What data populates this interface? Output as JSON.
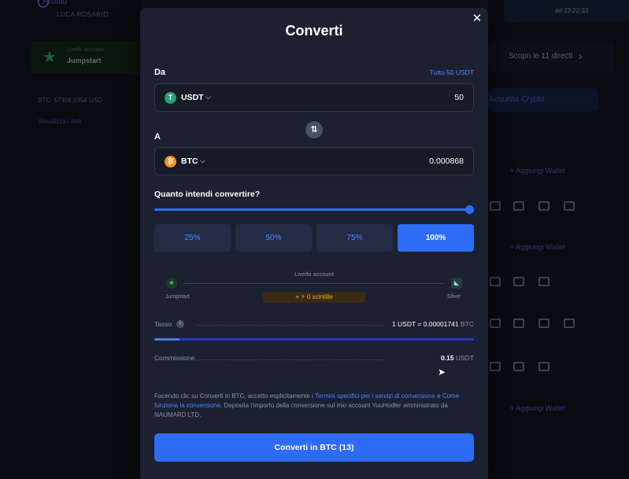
{
  "background": {
    "profile_label": "Profilo",
    "profile_name": "LUCA ROSARIO",
    "level_caption": "Livello account",
    "level_name": "Jumpstart",
    "btc_price": "BTC: 57308,0354 USD",
    "link": "Visualizza i dati",
    "datetime": "ad 23:22:33",
    "strip_text": "Scopri le 11 directi",
    "blue_bar_text": "Acquista Crypto",
    "add_wallet_1": "+ Aggiungi Wallet",
    "add_wallet_2": "+ Aggiungi Wallet",
    "add_wallet_3": "+ Aggiungi Wallet"
  },
  "modal": {
    "title": "Converti",
    "close_icon": "close-icon",
    "from": {
      "label": "Da",
      "all_link": "Tutto 50 USDT",
      "coin": "USDT",
      "amount": "50"
    },
    "to": {
      "label": "A",
      "coin": "BTC",
      "amount": "0.000868"
    },
    "slider": {
      "question": "Quanto intendi convertire?",
      "value_fraction": 1.0
    },
    "percent_options": [
      "25%",
      "50%",
      "75%",
      "100%"
    ],
    "selected_percent": "100%",
    "level": {
      "title": "Livello account",
      "start": "Jumpstart",
      "end": "Silver",
      "sparks": "+ ⚡ 0 scintille"
    },
    "rate": {
      "label": "Tasso",
      "value": "1 USDT = 0.00001741",
      "unit": "BTC",
      "progress_fraction": 0.08
    },
    "fee": {
      "label": "Commissione",
      "value": "0.15",
      "unit": "USDT"
    },
    "legal": {
      "part1": "Facendo clic su Converti in BTC, accetto esplicitamente i ",
      "link1": "Termini specifici per i servizi di conversione",
      "part2": " e ",
      "link2": "Come funziona la conversione",
      "part3": ". Deposita l'importo della conversione sul mio account YouHodler amministrato da NAUMARD LTD."
    },
    "convert_button": "Converti in BTC (13)"
  },
  "colors": {
    "accent": "#2f6cf6",
    "link": "#4f86ff",
    "modal_bg": "#1b2130",
    "usdt": "#26a17b",
    "btc": "#f7931a"
  }
}
